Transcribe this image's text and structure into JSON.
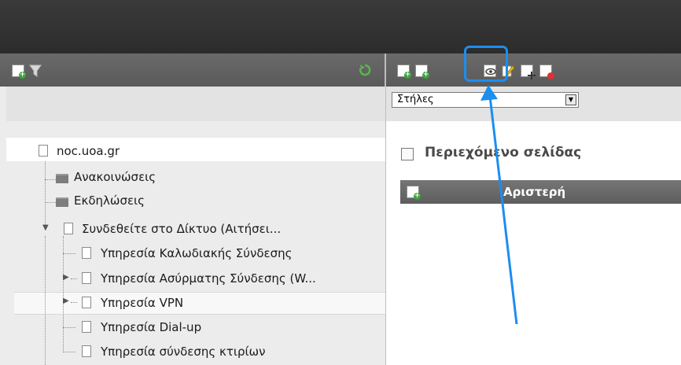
{
  "left_toolbar": {
    "icons": [
      "add-page-icon",
      "filter-icon",
      "refresh-icon"
    ]
  },
  "right_toolbar": {
    "icons": [
      "add-page-icon",
      "add-template-icon",
      "preview-icon",
      "edit-icon",
      "move-icon",
      "schedule-icon"
    ]
  },
  "columns_select": {
    "value": "Στήλες"
  },
  "tree": {
    "root": "noc.uoa.gr",
    "items": [
      "Ανακοινώσεις",
      "Εκδηλώσεις",
      "Συνδεθείτε στο Δίκτυο (Αιτήσει...",
      "Υπηρεσία Καλωδιακής Σύνδεσης",
      "Υπηρεσία Ασύρματης Σύνδεσης (W...",
      "Υπηρεσία VPN",
      "Υπηρεσία Dial-up",
      "Υπηρεσία σύνδεσης κτιρίων"
    ]
  },
  "page_content": {
    "title": "Περιεχόμενο σελίδας",
    "column_label": "Αριστερή"
  },
  "colors": {
    "highlight": "#1b8ef0",
    "toolbar": "#5f5f5f"
  }
}
